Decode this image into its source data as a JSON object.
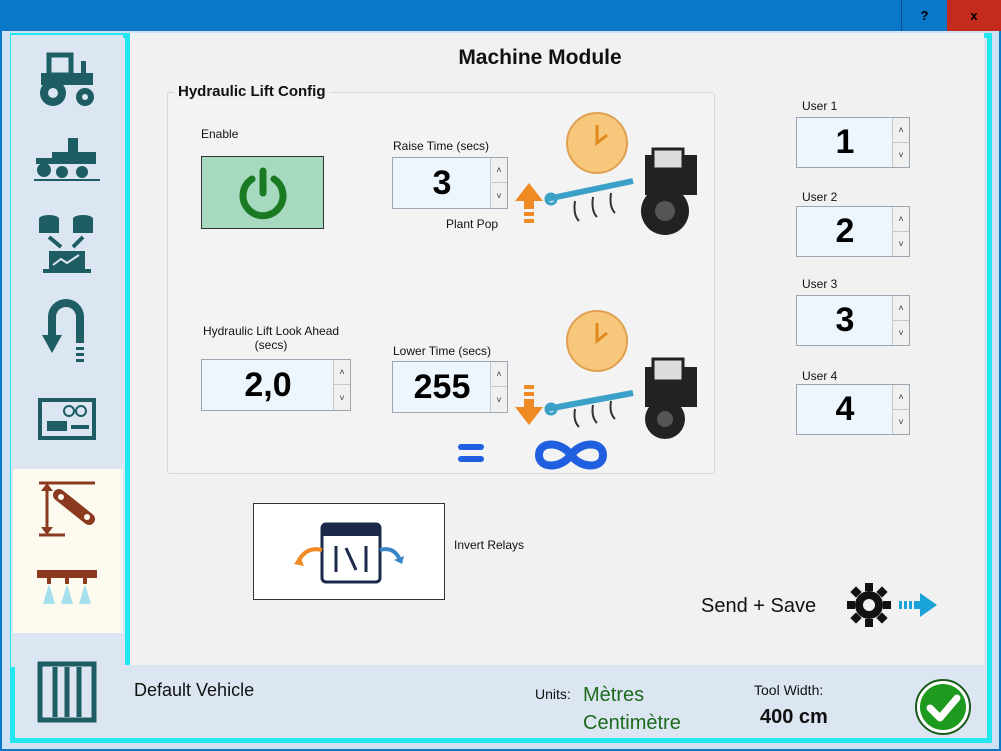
{
  "titlebar": {
    "help_label": "?",
    "close_label": "x"
  },
  "page": {
    "title": "Machine Module"
  },
  "group": {
    "label": "Hydraulic Lift Config"
  },
  "enable": {
    "label": "Enable"
  },
  "raise": {
    "label": "Raise Time (secs)",
    "value": "3",
    "up": "˄",
    "down": "˅"
  },
  "plant_pop": {
    "label": "Plant Pop"
  },
  "look_ahead": {
    "label": "Hydraulic Lift Look Ahead (secs)",
    "value": "2,0",
    "up": "˄",
    "down": "˅"
  },
  "lower": {
    "label": "Lower Time (secs)",
    "value": "255",
    "up": "˄",
    "down": "˅"
  },
  "invert": {
    "label": "Invert Relays"
  },
  "users": [
    {
      "label": "User 1",
      "value": "1"
    },
    {
      "label": "User 2",
      "value": "2"
    },
    {
      "label": "User 3",
      "value": "3"
    },
    {
      "label": "User 4",
      "value": "4"
    }
  ],
  "send_save": {
    "label": "Send + Save"
  },
  "footer": {
    "vehicle": "Default Vehicle",
    "units_label": "Units:",
    "units_primary": "Mètres",
    "units_secondary": "Centimètre",
    "tool_width_label": "Tool Width:",
    "tool_width_value": "400 cm"
  },
  "sidebar": {
    "items": [
      "tractor-icon",
      "planter-icon",
      "data-transfer-icon",
      "u-turn-icon",
      "arduino-board-icon",
      "hydraulic-lift-icon",
      "sprayer-section-icon",
      "container-icon"
    ]
  },
  "colors": {
    "accent": "#22e7f0",
    "title_bar": "#0a77c9",
    "enable_bg": "#a7d9c0",
    "ok_green": "#1e9a1e",
    "units_green": "#1c6b1c"
  }
}
